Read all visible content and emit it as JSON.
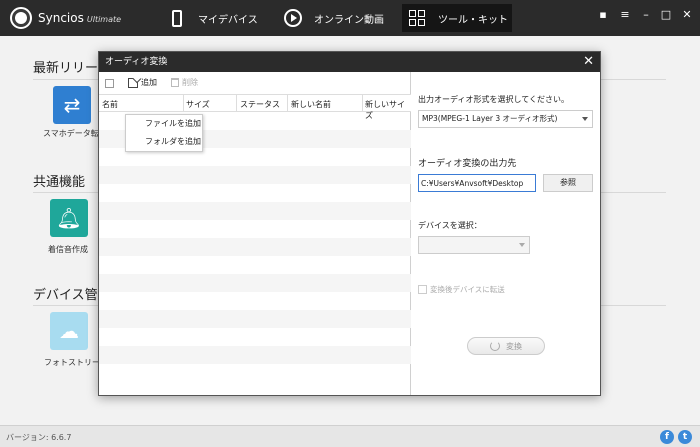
{
  "app": {
    "brand": "Syncios",
    "edition": "Ultimate"
  },
  "nav": {
    "tabs": [
      {
        "label": "マイデバイス",
        "icon": "phone-icon"
      },
      {
        "label": "オンライン動画",
        "icon": "play-icon"
      },
      {
        "label": "ツール・キット",
        "icon": "toolkit-icon",
        "active": true
      }
    ]
  },
  "window_controls": [
    "message-icon",
    "menu-icon",
    "minimize-icon",
    "maximize-icon",
    "close-icon"
  ],
  "background": {
    "sections": [
      {
        "title": "最新リリー",
        "tile_label": "スマホデータ転送",
        "tile_icon": "transfer-icon",
        "tile_color": "#2f7fd1"
      },
      {
        "title": "共通機能",
        "tile_label": "着信音作成",
        "tile_icon": "bell-icon",
        "tile_color": "#1fa79a"
      },
      {
        "title": "デバイス管",
        "tile_label": "フォトストリーム",
        "tile_icon": "cloud-icon",
        "tile_color": "#a8dcf0"
      }
    ]
  },
  "status": {
    "version": "バージョン: 6.6.7"
  },
  "social": [
    "facebook-icon",
    "twitter-icon"
  ],
  "dialog": {
    "title": "オーディオ変換",
    "toolbar": {
      "add_label": "追加",
      "delete_label": "削除"
    },
    "table": {
      "columns": [
        "名前",
        "サイズ",
        "ステータス",
        "新しい名前",
        "新しいサイズ"
      ]
    },
    "add_menu": {
      "items": [
        "ファイルを追加",
        "フォルダを追加"
      ]
    },
    "right": {
      "format_label": "出力オーディオ形式を選択してください。",
      "format_value": "MP3(MPEG-1 Layer 3 オーディオ形式)",
      "output_label": "オーディオ変換の出力先",
      "output_path": "C:¥Users¥Anvsoft¥Desktop",
      "browse_label": "参照",
      "device_label": "デバイスを選択：",
      "device_value": "",
      "transfer_label": "変換後デバイスに転送",
      "convert_label": "変換"
    }
  },
  "colors": {
    "topbar": "#2b2b2b",
    "accent": "#3a7bd5"
  }
}
